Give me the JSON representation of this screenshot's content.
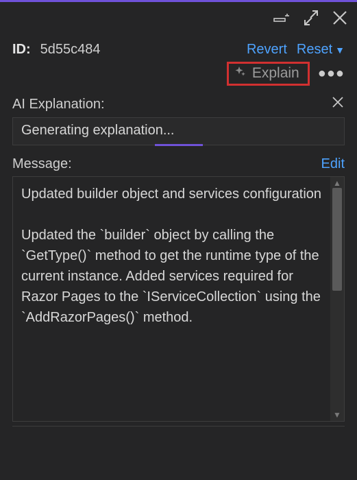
{
  "header": {
    "id_label": "ID:",
    "id_value": "5d55c484",
    "revert_label": "Revert",
    "reset_label": "Reset"
  },
  "explain": {
    "label": "Explain"
  },
  "ai_section": {
    "title": "AI Explanation:",
    "status": "Generating explanation..."
  },
  "message_section": {
    "title": "Message:",
    "edit_label": "Edit",
    "body": "Updated builder object and services configuration\n\nUpdated the `builder` object by calling the `GetType()` method to get the runtime type of the current instance. Added services required for Razor Pages to the `IServiceCollection` using the `AddRazorPages()` method."
  }
}
